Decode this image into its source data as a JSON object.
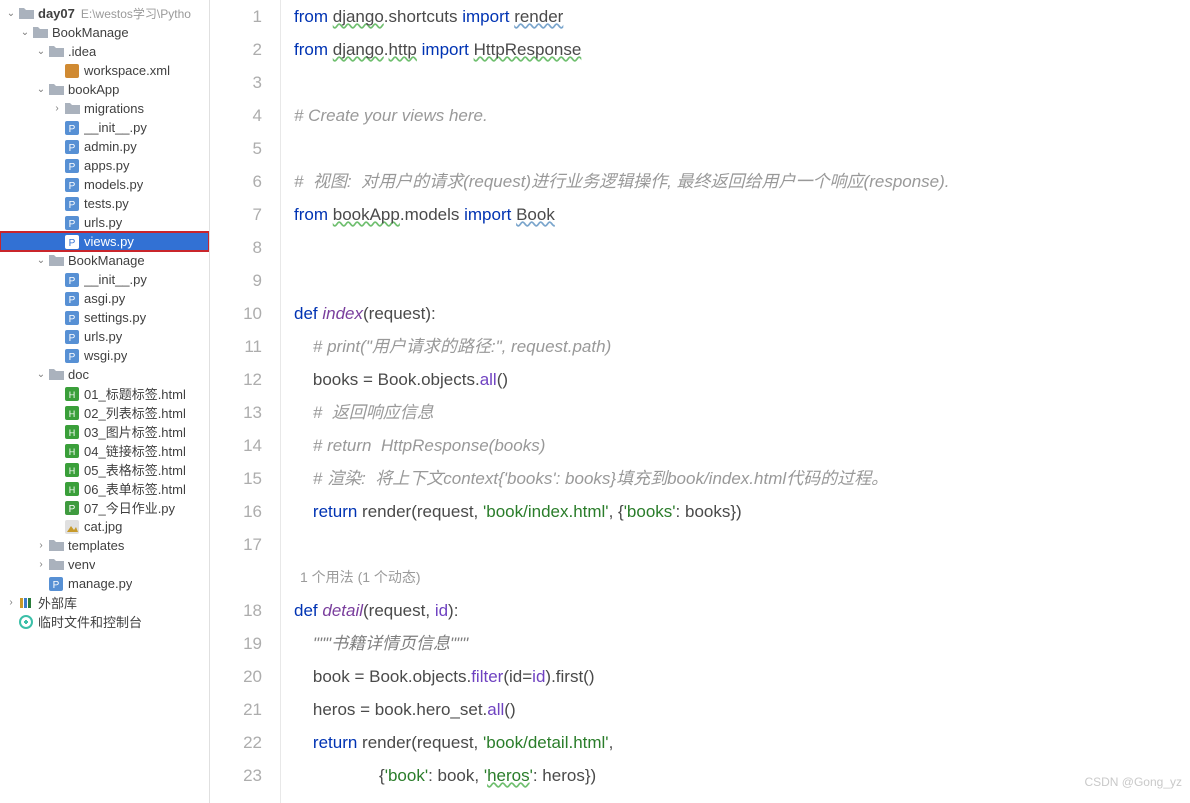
{
  "sidebar": {
    "root": {
      "name": "day07",
      "path": "E:\\westos学习\\Pytho"
    },
    "items": [
      {
        "lvl": 0,
        "tog": "v",
        "icon": "folder-root",
        "label_key": "root",
        "interact": true
      },
      {
        "lvl": 1,
        "tog": "v",
        "icon": "folder",
        "label": "BookManage",
        "interact": true
      },
      {
        "lvl": 2,
        "tog": "v",
        "icon": "folder",
        "label": ".idea",
        "interact": true
      },
      {
        "lvl": 3,
        "tog": "",
        "icon": "xml",
        "label": "workspace.xml",
        "interact": true
      },
      {
        "lvl": 2,
        "tog": "v",
        "icon": "folder",
        "label": "bookApp",
        "interact": true
      },
      {
        "lvl": 3,
        "tog": ">",
        "icon": "folder",
        "label": "migrations",
        "interact": true
      },
      {
        "lvl": 3,
        "tog": "",
        "icon": "py",
        "label": "__init__.py",
        "interact": true
      },
      {
        "lvl": 3,
        "tog": "",
        "icon": "py",
        "label": "admin.py",
        "interact": true
      },
      {
        "lvl": 3,
        "tog": "",
        "icon": "py",
        "label": "apps.py",
        "interact": true
      },
      {
        "lvl": 3,
        "tog": "",
        "icon": "py",
        "label": "models.py",
        "interact": true
      },
      {
        "lvl": 3,
        "tog": "",
        "icon": "py",
        "label": "tests.py",
        "interact": true
      },
      {
        "lvl": 3,
        "tog": "",
        "icon": "py",
        "label": "urls.py",
        "interact": true
      },
      {
        "lvl": 3,
        "tog": "",
        "icon": "py",
        "label": "views.py",
        "interact": true,
        "selected": true,
        "highlight": true
      },
      {
        "lvl": 2,
        "tog": "v",
        "icon": "folder",
        "label": "BookManage",
        "interact": true
      },
      {
        "lvl": 3,
        "tog": "",
        "icon": "py",
        "label": "__init__.py",
        "interact": true
      },
      {
        "lvl": 3,
        "tog": "",
        "icon": "py",
        "label": "asgi.py",
        "interact": true
      },
      {
        "lvl": 3,
        "tog": "",
        "icon": "py",
        "label": "settings.py",
        "interact": true
      },
      {
        "lvl": 3,
        "tog": "",
        "icon": "py",
        "label": "urls.py",
        "interact": true
      },
      {
        "lvl": 3,
        "tog": "",
        "icon": "py",
        "label": "wsgi.py",
        "interact": true
      },
      {
        "lvl": 2,
        "tog": "v",
        "icon": "folder",
        "label": "doc",
        "interact": true
      },
      {
        "lvl": 3,
        "tog": "",
        "icon": "html",
        "label": "01_标题标签.html",
        "interact": true
      },
      {
        "lvl": 3,
        "tog": "",
        "icon": "html",
        "label": "02_列表标签.html",
        "interact": true
      },
      {
        "lvl": 3,
        "tog": "",
        "icon": "html",
        "label": "03_图片标签.html",
        "interact": true
      },
      {
        "lvl": 3,
        "tog": "",
        "icon": "html",
        "label": "04_链接标签.html",
        "interact": true
      },
      {
        "lvl": 3,
        "tog": "",
        "icon": "html",
        "label": "05_表格标签.html",
        "interact": true
      },
      {
        "lvl": 3,
        "tog": "",
        "icon": "html",
        "label": "06_表单标签.html",
        "interact": true
      },
      {
        "lvl": 3,
        "tog": "",
        "icon": "pyg",
        "label": "07_今日作业.py",
        "interact": true
      },
      {
        "lvl": 3,
        "tog": "",
        "icon": "img",
        "label": "cat.jpg",
        "interact": true
      },
      {
        "lvl": 2,
        "tog": ">",
        "icon": "folder",
        "label": "templates",
        "interact": true
      },
      {
        "lvl": 2,
        "tog": ">",
        "icon": "folder",
        "label": "venv",
        "interact": true
      },
      {
        "lvl": 2,
        "tog": "",
        "icon": "py",
        "label": "manage.py",
        "interact": true
      },
      {
        "lvl": 0,
        "tog": ">",
        "icon": "lib",
        "label": "外部库",
        "interact": true
      },
      {
        "lvl": 0,
        "tog": "",
        "icon": "scratch",
        "label": "临时文件和控制台",
        "interact": true
      }
    ]
  },
  "editor": {
    "usages_hint": "1 个用法 (1 个动态)",
    "watermark": "CSDN @Gong_yz",
    "lines": [
      {
        "n": 1,
        "tokens": [
          {
            "t": "from ",
            "c": "kw"
          },
          {
            "t": "django",
            "c": "sq"
          },
          {
            "t": ".shortcuts ",
            "c": "idm"
          },
          {
            "t": "import ",
            "c": "kw"
          },
          {
            "t": "render",
            "c": "sq2"
          }
        ]
      },
      {
        "n": 2,
        "tokens": [
          {
            "t": "from ",
            "c": "kw"
          },
          {
            "t": "django",
            "c": "sq"
          },
          {
            "t": ".",
            "c": "idm"
          },
          {
            "t": "http",
            "c": "sq"
          },
          {
            "t": " ",
            "c": "idm"
          },
          {
            "t": "import ",
            "c": "kw"
          },
          {
            "t": "HttpResponse",
            "c": "sq"
          }
        ]
      },
      {
        "n": 3,
        "tokens": [
          {
            "t": "",
            "c": "idm"
          }
        ]
      },
      {
        "n": 4,
        "tokens": [
          {
            "t": "# Create your views here.",
            "c": "com"
          }
        ]
      },
      {
        "n": 5,
        "tokens": [
          {
            "t": "",
            "c": "idm"
          }
        ]
      },
      {
        "n": 6,
        "tokens": [
          {
            "t": "#  视图:  对用户的请求(request)进行业务逻辑操作, 最终返回给用户一个响应(response).",
            "c": "com"
          }
        ]
      },
      {
        "n": 7,
        "tokens": [
          {
            "t": "from ",
            "c": "kw"
          },
          {
            "t": "bookApp",
            "c": "sq"
          },
          {
            "t": ".models ",
            "c": "idm"
          },
          {
            "t": "import ",
            "c": "kw"
          },
          {
            "t": "Book",
            "c": "sq2"
          }
        ]
      },
      {
        "n": 8,
        "tokens": [
          {
            "t": "",
            "c": "idm"
          }
        ]
      },
      {
        "n": 9,
        "tokens": [
          {
            "t": "",
            "c": "idm"
          }
        ]
      },
      {
        "n": 10,
        "tokens": [
          {
            "t": "def ",
            "c": "kw"
          },
          {
            "t": "index",
            "c": "fn"
          },
          {
            "t": "(request):",
            "c": "idm"
          }
        ]
      },
      {
        "n": 11,
        "tokens": [
          {
            "t": "    ",
            "c": "idm"
          },
          {
            "t": "# print(\"用户请求的路径:\", request.path)",
            "c": "com"
          }
        ]
      },
      {
        "n": 12,
        "tokens": [
          {
            "t": "    books = Book.objects.",
            "c": "idm"
          },
          {
            "t": "all",
            "c": "bif"
          },
          {
            "t": "()",
            "c": "idm"
          }
        ]
      },
      {
        "n": 13,
        "tokens": [
          {
            "t": "    ",
            "c": "idm"
          },
          {
            "t": "#  返回响应信息",
            "c": "com"
          }
        ]
      },
      {
        "n": 14,
        "tokens": [
          {
            "t": "    ",
            "c": "idm"
          },
          {
            "t": "# return  HttpResponse(books)",
            "c": "com"
          }
        ]
      },
      {
        "n": 15,
        "tokens": [
          {
            "t": "    ",
            "c": "idm"
          },
          {
            "t": "# 渲染:  将上下文context{'books': books}填充到book/index.html代码的过程。",
            "c": "com"
          }
        ]
      },
      {
        "n": 16,
        "tokens": [
          {
            "t": "    ",
            "c": "idm"
          },
          {
            "t": "return ",
            "c": "kw"
          },
          {
            "t": "render(request, ",
            "c": "idm"
          },
          {
            "t": "'book/index.html'",
            "c": "str"
          },
          {
            "t": ", {",
            "c": "idm"
          },
          {
            "t": "'books'",
            "c": "str"
          },
          {
            "t": ": books})",
            "c": "idm"
          }
        ]
      },
      {
        "n": 17,
        "tokens": [
          {
            "t": "",
            "c": "idm"
          }
        ]
      },
      {
        "n": 18,
        "tokens": [
          {
            "t": "def ",
            "c": "kw"
          },
          {
            "t": "detail",
            "c": "fn"
          },
          {
            "t": "(request, ",
            "c": "idm"
          },
          {
            "t": "id",
            "c": "bif"
          },
          {
            "t": "):",
            "c": "idm"
          }
        ]
      },
      {
        "n": 19,
        "tokens": [
          {
            "t": "    ",
            "c": "idm"
          },
          {
            "t": "\"\"\"书籍详情页信息\"\"\"",
            "c": "ds"
          }
        ]
      },
      {
        "n": 20,
        "tokens": [
          {
            "t": "    book = Book.objects.",
            "c": "idm"
          },
          {
            "t": "filter",
            "c": "bif"
          },
          {
            "t": "(",
            "c": "idm"
          },
          {
            "t": "id",
            "c": "idm"
          },
          {
            "t": "=",
            "c": "idm"
          },
          {
            "t": "id",
            "c": "bif"
          },
          {
            "t": ").first()",
            "c": "idm"
          }
        ]
      },
      {
        "n": 21,
        "tokens": [
          {
            "t": "    heros = book.hero_set.",
            "c": "idm"
          },
          {
            "t": "all",
            "c": "bif"
          },
          {
            "t": "()",
            "c": "idm"
          }
        ]
      },
      {
        "n": 22,
        "tokens": [
          {
            "t": "    ",
            "c": "idm"
          },
          {
            "t": "return ",
            "c": "kw"
          },
          {
            "t": "render(request, ",
            "c": "idm"
          },
          {
            "t": "'book/detail.html'",
            "c": "str"
          },
          {
            "t": ",",
            "c": "idm"
          }
        ]
      },
      {
        "n": 23,
        "tokens": [
          {
            "t": "                  {",
            "c": "idm"
          },
          {
            "t": "'book'",
            "c": "str"
          },
          {
            "t": ": book, ",
            "c": "idm"
          },
          {
            "t": "'",
            "c": "str"
          },
          {
            "t": "heros",
            "c": "sq str"
          },
          {
            "t": "'",
            "c": "str"
          },
          {
            "t": ": heros})",
            "c": "idm"
          }
        ]
      }
    ]
  }
}
